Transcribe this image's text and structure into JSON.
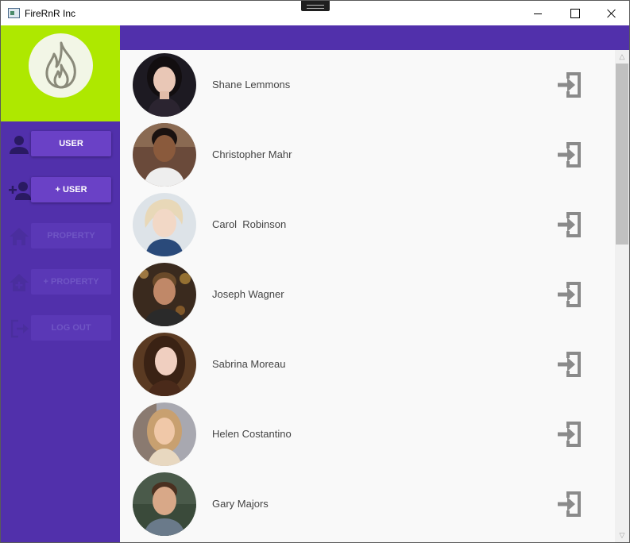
{
  "window": {
    "title": "FireRnR Inc"
  },
  "sidebar": {
    "items": [
      {
        "label": "USER",
        "icon": "person-icon",
        "enabled": true
      },
      {
        "label": "+ USER",
        "icon": "person-add-icon",
        "enabled": true
      },
      {
        "label": "PROPERTY",
        "icon": "home-icon",
        "enabled": false
      },
      {
        "label": "+ PROPERTY",
        "icon": "home-add-icon",
        "enabled": false
      },
      {
        "label": "LOG OUT",
        "icon": "logout-icon",
        "enabled": false
      }
    ]
  },
  "users": [
    {
      "name": "Shane Lemmons"
    },
    {
      "name": "Christopher Mahr"
    },
    {
      "name": "Carol  Robinson"
    },
    {
      "name": "Joseph Wagner"
    },
    {
      "name": "Sabrina Moreau"
    },
    {
      "name": "Helen Costantino"
    },
    {
      "name": "Gary Majors"
    }
  ],
  "colors": {
    "accent": "#5130ab",
    "logo_bg": "#aee800",
    "button": "#6a41c6",
    "icon_gray": "#8a8a8a"
  },
  "icons": {
    "logo": "flame-icon",
    "row_action": "sign-in-icon",
    "scroll_up": "arrow-up-icon",
    "scroll_down": "arrow-down-icon"
  }
}
